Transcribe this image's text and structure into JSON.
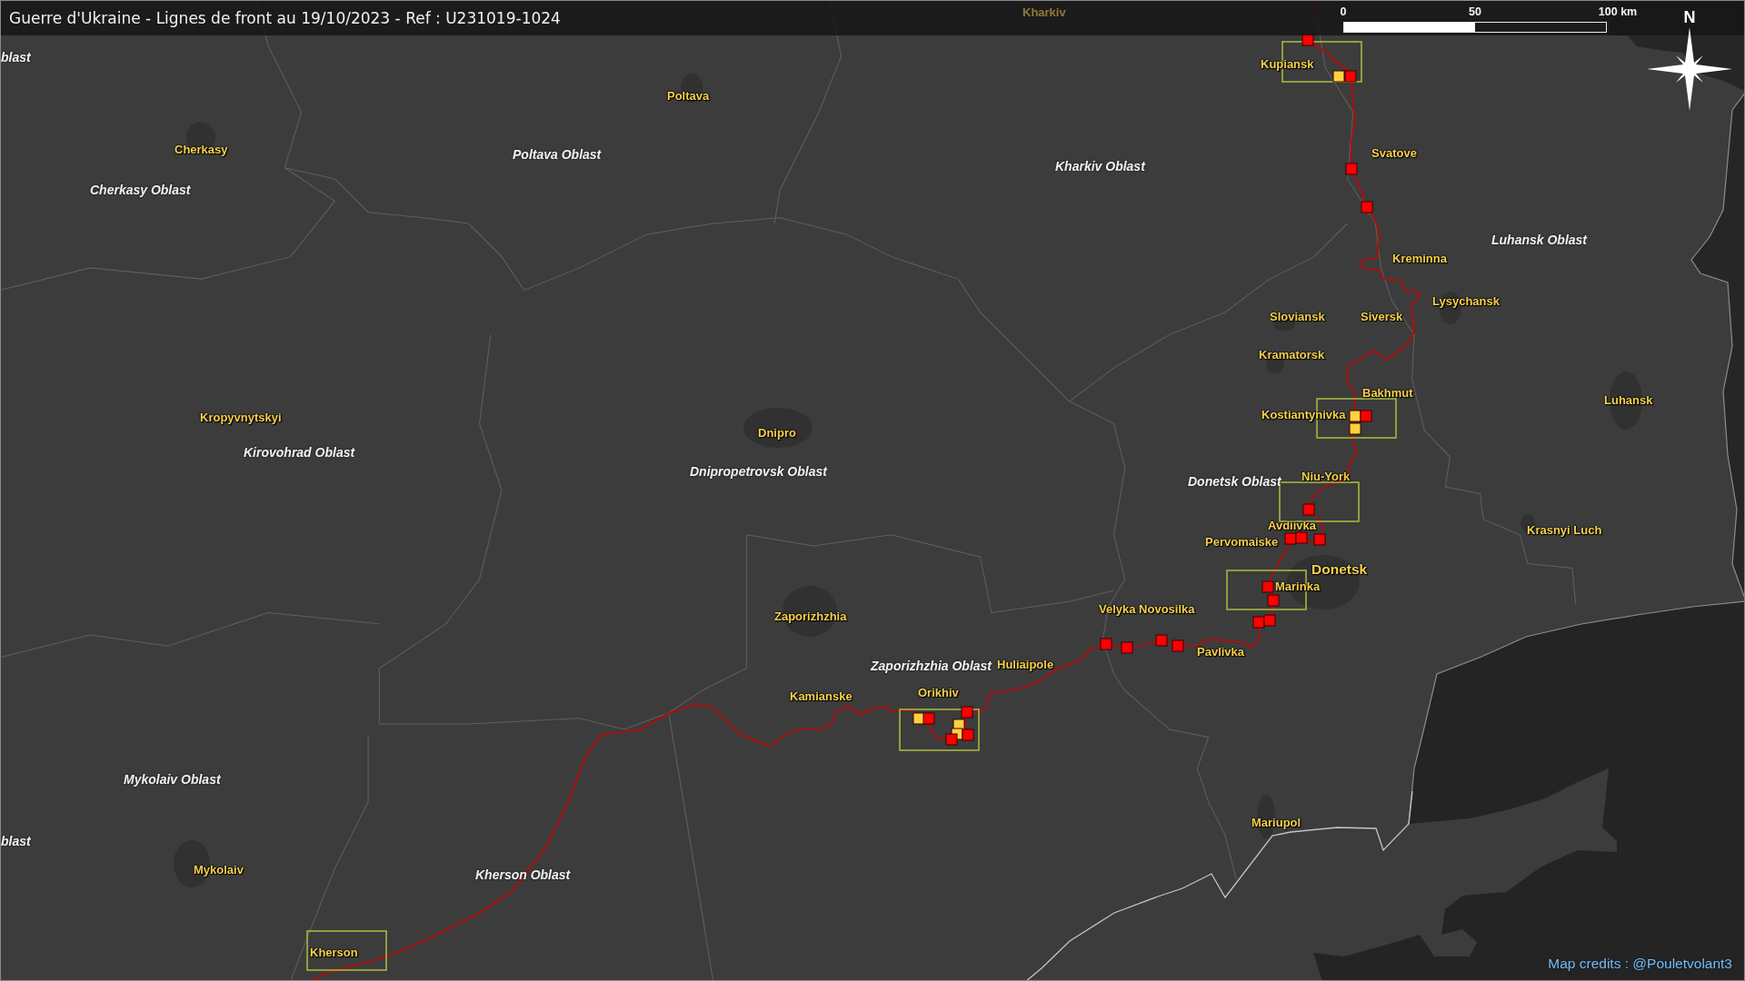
{
  "title": "Guerre d'Ukraine - Lignes de front au 19/10/2023 - Ref : U231019-1024",
  "scale_bar": {
    "ticks": [
      "0",
      "50",
      "100 km"
    ]
  },
  "compass": {
    "label": "N"
  },
  "regions": [
    {
      "name": "blast"
    },
    {
      "name": "Cherkasy Oblast"
    },
    {
      "name": "Poltava Oblast"
    },
    {
      "name": "Kharkiv Oblast"
    },
    {
      "name": "Luhansk Oblast"
    },
    {
      "name": "Kirovohrad Oblast"
    },
    {
      "name": "Dnipropetrovsk Oblast"
    },
    {
      "name": "Donetsk Oblast"
    },
    {
      "name": "Zaporizhzhia Oblast"
    },
    {
      "name": "Mykolaiv Oblast"
    },
    {
      "name": "blast"
    },
    {
      "name": "Kherson Oblast"
    }
  ],
  "cities": [
    {
      "name": "Kharkiv",
      "kind": "town",
      "dimmed": true
    },
    {
      "name": "Kupiansk",
      "kind": "town",
      "dimmed": false
    },
    {
      "name": "Poltava",
      "kind": "town",
      "dimmed": false
    },
    {
      "name": "Cherkasy",
      "kind": "town",
      "dimmed": false
    },
    {
      "name": "Svatove",
      "kind": "town",
      "dimmed": false
    },
    {
      "name": "Kreminna",
      "kind": "town",
      "dimmed": false
    },
    {
      "name": "Lysychansk",
      "kind": "town",
      "dimmed": false
    },
    {
      "name": "Sloviansk",
      "kind": "town",
      "dimmed": false
    },
    {
      "name": "Siversk",
      "kind": "town",
      "dimmed": false
    },
    {
      "name": "Kramatorsk",
      "kind": "town",
      "dimmed": false
    },
    {
      "name": "Bakhmut",
      "kind": "town",
      "dimmed": false
    },
    {
      "name": "Kostiantynivka",
      "kind": "town",
      "dimmed": false
    },
    {
      "name": "Luhansk",
      "kind": "town",
      "dimmed": false
    },
    {
      "name": "Kropyvnytskyi",
      "kind": "town",
      "dimmed": false
    },
    {
      "name": "Dnipro",
      "kind": "town",
      "dimmed": false
    },
    {
      "name": "Niu-York",
      "kind": "town",
      "dimmed": false
    },
    {
      "name": "Avdiivka",
      "kind": "town",
      "dimmed": false
    },
    {
      "name": "Krasnyi Luch",
      "kind": "town",
      "dimmed": false
    },
    {
      "name": "Pervomaiske",
      "kind": "town",
      "dimmed": false
    },
    {
      "name": "Donetsk",
      "kind": "city",
      "dimmed": false
    },
    {
      "name": "Marinka",
      "kind": "town",
      "dimmed": false
    },
    {
      "name": "Zaporizhzhia",
      "kind": "town",
      "dimmed": false
    },
    {
      "name": "Velyka Novosilka",
      "kind": "town",
      "dimmed": false
    },
    {
      "name": "Pavlivka",
      "kind": "town",
      "dimmed": false
    },
    {
      "name": "Huliaipole",
      "kind": "town",
      "dimmed": false
    },
    {
      "name": "Orikhiv",
      "kind": "town",
      "dimmed": false
    },
    {
      "name": "Kamianske",
      "kind": "town",
      "dimmed": false
    },
    {
      "name": "Mariupol",
      "kind": "town",
      "dimmed": false
    },
    {
      "name": "Mykolaiv",
      "kind": "town",
      "dimmed": false
    },
    {
      "name": "Kherson",
      "kind": "town",
      "dimmed": false
    }
  ],
  "markers": [
    {
      "color": "#ff0000"
    },
    {
      "color": "#fdd13e"
    },
    {
      "color": "#ff0000"
    },
    {
      "color": "#ff0000"
    },
    {
      "color": "#ff0000"
    },
    {
      "color": "#fdd13e"
    },
    {
      "color": "#ff0000"
    },
    {
      "color": "#fdd13e"
    },
    {
      "color": "#ff0000"
    },
    {
      "color": "#ff0000"
    },
    {
      "color": "#ff0000"
    },
    {
      "color": "#ff0000"
    },
    {
      "color": "#ff0000"
    },
    {
      "color": "#ff0000"
    },
    {
      "color": "#ff0000"
    },
    {
      "color": "#ff0000"
    },
    {
      "color": "#ff0000"
    },
    {
      "color": "#ff0000"
    },
    {
      "color": "#ff0000"
    },
    {
      "color": "#ff0000"
    },
    {
      "color": "#fdd13e"
    },
    {
      "color": "#ff0000"
    },
    {
      "color": "#ff0000"
    },
    {
      "color": "#fdd13e"
    },
    {
      "color": "#fdd13e"
    },
    {
      "color": "#ff0000"
    },
    {
      "color": "#ff0000"
    }
  ],
  "credits": "Map credits : @Pouletvolant3"
}
